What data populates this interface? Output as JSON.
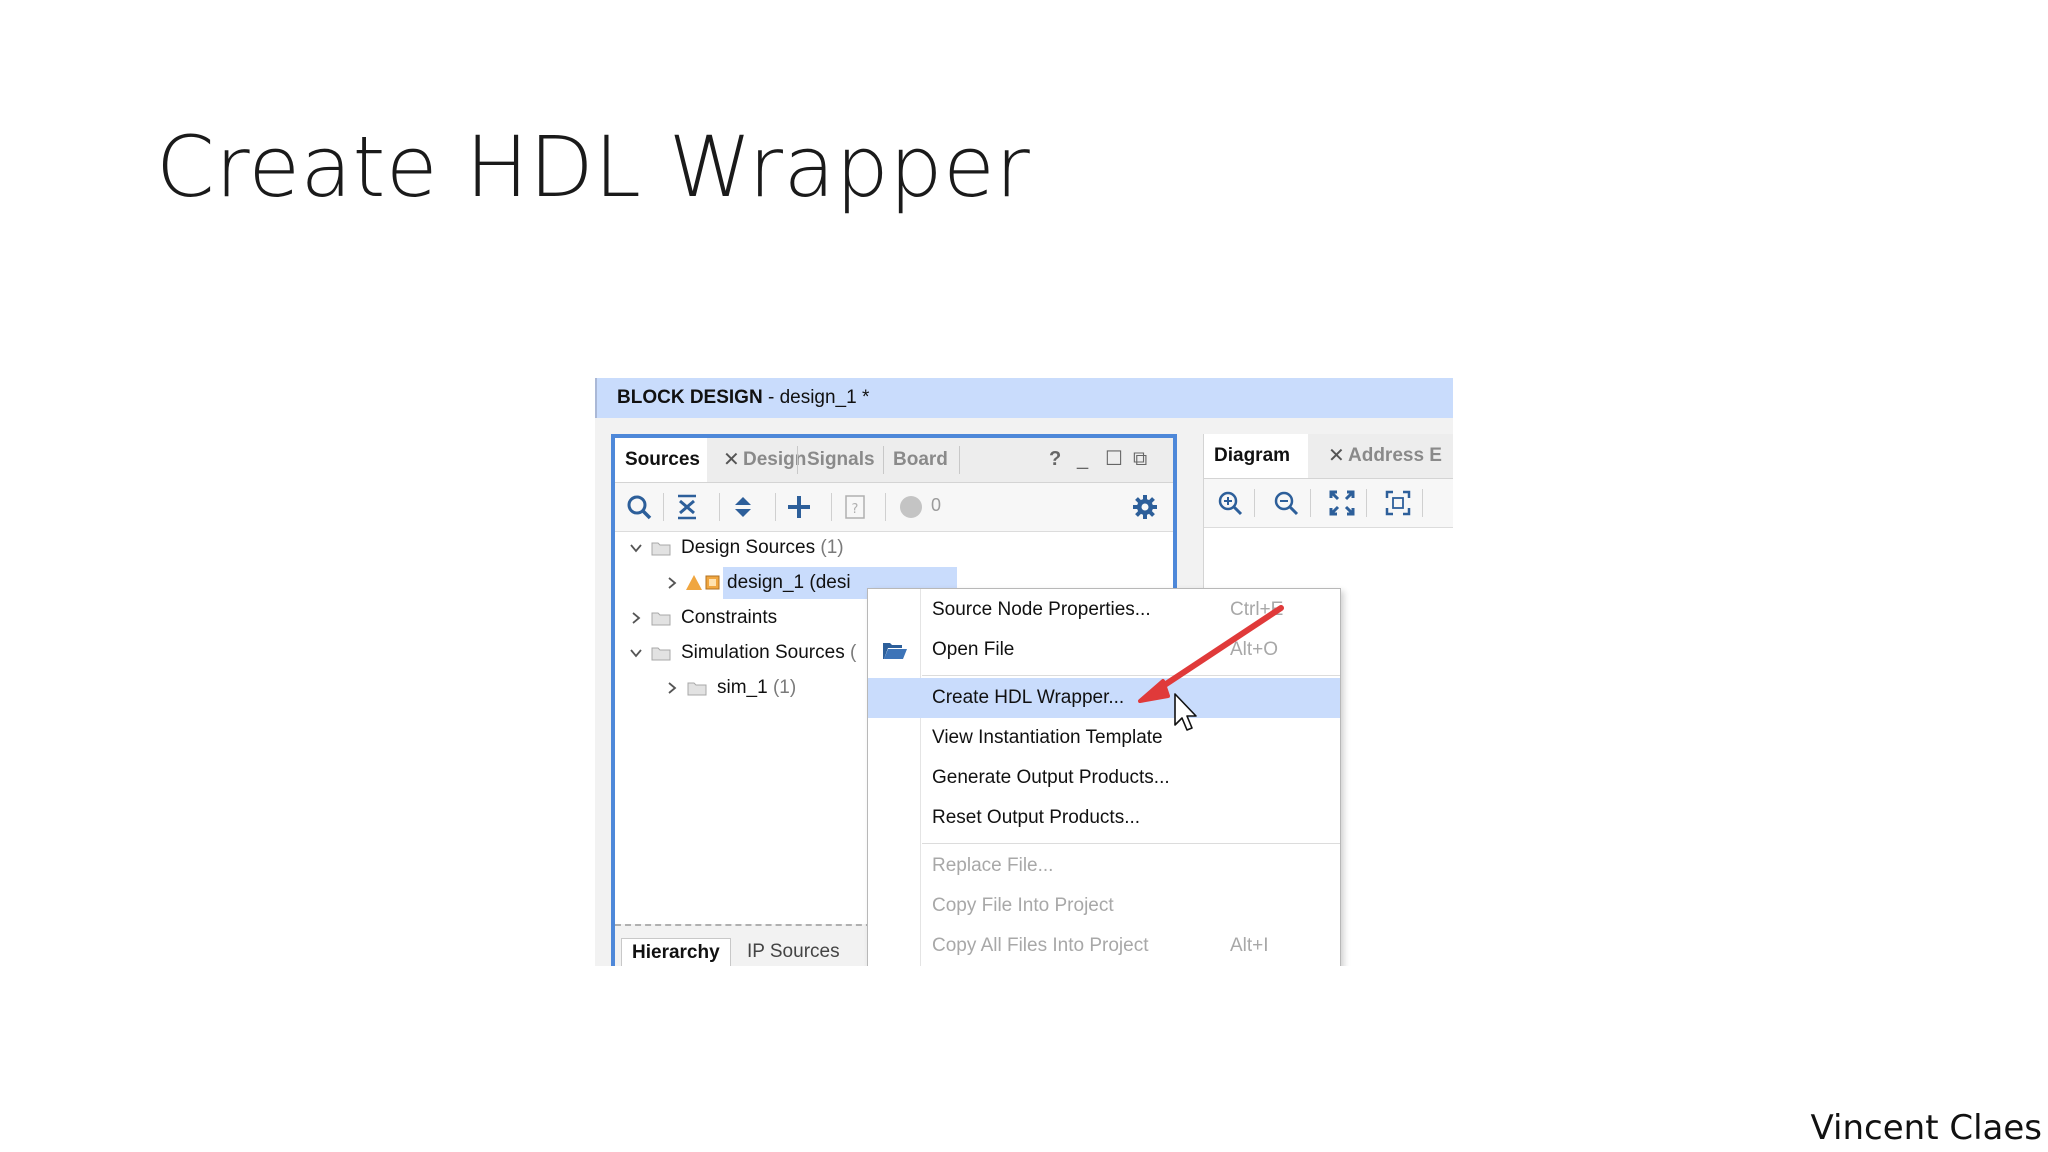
{
  "slide": {
    "title": "Create HDL Wrapper",
    "author": "Vincent Claes"
  },
  "screenshot": {
    "header": {
      "bold": "BLOCK DESIGN",
      "rest": " - design_1 *"
    },
    "sources_panel": {
      "tabs": [
        "Sources",
        "Design",
        "Signals",
        "Board"
      ],
      "active_tab": "Sources",
      "window_controls": [
        "?",
        "minimize",
        "maximize",
        "float"
      ],
      "toolbar": {
        "icons": [
          "search-icon",
          "collapse-all-icon",
          "expand-all-icon",
          "add-icon",
          "unknown-file-icon",
          "status-dot-icon",
          "gear-icon"
        ],
        "count": "0"
      },
      "tree": [
        {
          "label": "Design Sources",
          "count": "(1)",
          "level": 0,
          "expanded": true
        },
        {
          "label": "design_1 (desi",
          "count": "",
          "level": 1,
          "expanded": false,
          "selected": true
        },
        {
          "label": "Constraints",
          "count": "",
          "level": 0,
          "expanded": false
        },
        {
          "label": "Simulation Sources",
          "count": "(",
          "level": 0,
          "expanded": true
        },
        {
          "label": "sim_1",
          "count": "(1)",
          "level": 1,
          "expanded": false
        }
      ],
      "bottom_tabs": [
        "Hierarchy",
        "IP Sources"
      ],
      "active_bottom_tab": "Hierarchy"
    },
    "diagram_panel": {
      "tabs": [
        "Diagram",
        "Address E"
      ],
      "active_tab": "Diagram",
      "toolbar_icons": [
        "zoom-in-icon",
        "zoom-out-icon",
        "zoom-fit-icon",
        "zoom-selection-icon"
      ]
    },
    "context_menu": {
      "items": [
        {
          "label": "Source Node Properties...",
          "shortcut": "Ctrl+E",
          "enabled": true,
          "highlighted": false
        },
        {
          "label": "Open File",
          "shortcut": "Alt+O",
          "enabled": true,
          "highlighted": false,
          "icon": "folder-open-icon"
        },
        {
          "label": "Create HDL Wrapper...",
          "shortcut": "",
          "enabled": true,
          "highlighted": true
        },
        {
          "label": "View Instantiation Template",
          "shortcut": "",
          "enabled": true,
          "highlighted": false
        },
        {
          "label": "Generate Output Products...",
          "shortcut": "",
          "enabled": true,
          "highlighted": false
        },
        {
          "label": "Reset Output Products...",
          "shortcut": "",
          "enabled": true,
          "highlighted": false
        },
        {
          "label": "Replace File...",
          "shortcut": "",
          "enabled": false,
          "highlighted": false
        },
        {
          "label": "Copy File Into Project",
          "shortcut": "",
          "enabled": false,
          "highlighted": false
        },
        {
          "label": "Copy All Files Into Project",
          "shortcut": "Alt+I",
          "enabled": false,
          "highlighted": false
        }
      ]
    },
    "colors": {
      "header_bg": "#c9dcfc",
      "panel_border": "#4e88d9",
      "highlight": "#c9dcfc",
      "annotation_arrow": "#e03a3a",
      "gear": "#2d5f9a"
    }
  }
}
